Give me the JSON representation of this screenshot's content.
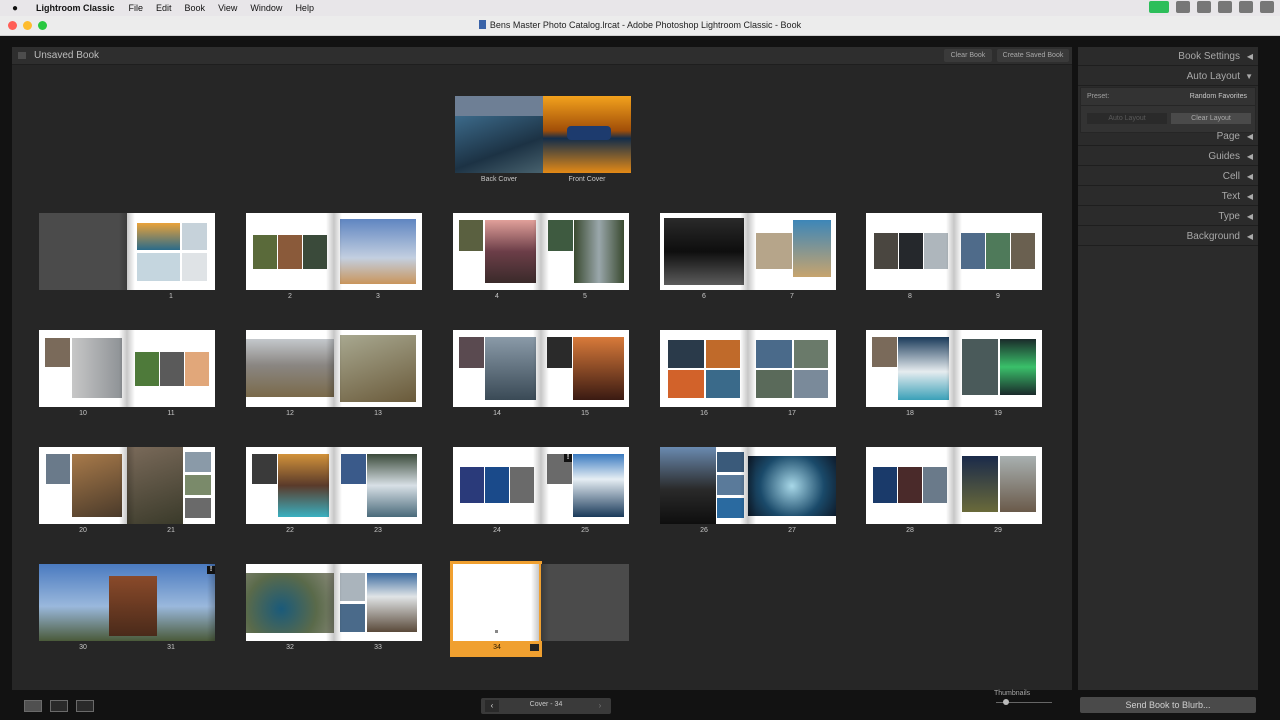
{
  "menubar": {
    "app_name": "Lightroom Classic",
    "menus": [
      "File",
      "Edit",
      "Book",
      "View",
      "Window",
      "Help"
    ]
  },
  "window": {
    "title": "Bens Master Photo Catalog.lrcat - Adobe Photoshop Lightroom Classic - Book"
  },
  "header": {
    "title": "Unsaved Book",
    "clear_book": "Clear Book",
    "create_saved_book": "Create Saved Book"
  },
  "cover": {
    "back_label": "Back Cover",
    "front_label": "Front Cover"
  },
  "page_numbers": [
    "1",
    "2",
    "3",
    "4",
    "5",
    "6",
    "7",
    "8",
    "9",
    "10",
    "11",
    "12",
    "13",
    "14",
    "15",
    "16",
    "17",
    "18",
    "19",
    "20",
    "21",
    "22",
    "23",
    "24",
    "25",
    "26",
    "27",
    "28",
    "29",
    "30",
    "31",
    "32",
    "33",
    "34"
  ],
  "right_panel": {
    "book_settings": "Book Settings",
    "auto_layout": "Auto Layout",
    "preset_label": "Preset:",
    "preset_value": "Random Favorites",
    "auto_layout_button": "Auto Layout",
    "clear_layout_button": "Clear Layout",
    "sections": [
      "Page",
      "Guides",
      "Cell",
      "Text",
      "Type",
      "Background"
    ]
  },
  "footer": {
    "nav_label": "Cover - 34",
    "thumbnails_label": "Thumbnails",
    "send_button": "Send Book to Blurb..."
  },
  "colors": {
    "selection": "#f0a030",
    "panel": "#2b2b2b",
    "canvas": "#262626"
  }
}
